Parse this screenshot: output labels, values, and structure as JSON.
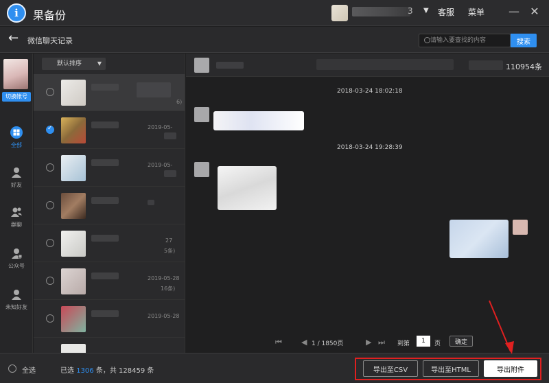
{
  "app": {
    "title": "果备份",
    "user_suffix": "3",
    "service": "客服",
    "menu": "菜单"
  },
  "header": {
    "title": "微信聊天记录",
    "search_placeholder": "请输入要查找的内容",
    "search_button": "搜索"
  },
  "leftnav": {
    "switch_account": "切换帐号",
    "items": [
      {
        "label": "全部",
        "icon": "grid-icon",
        "active": true
      },
      {
        "label": "好友",
        "icon": "person-icon",
        "active": false
      },
      {
        "label": "群聊",
        "icon": "group-icon",
        "active": false
      },
      {
        "label": "公众号",
        "icon": "official-account-icon",
        "active": false
      },
      {
        "label": "未知好友",
        "icon": "unknown-friend-icon",
        "active": false
      }
    ]
  },
  "conversations": {
    "sort_label": "默认排序",
    "rows": [
      {
        "date": "",
        "count": "6)",
        "checked": false,
        "selected": true
      },
      {
        "date": "2019-05-",
        "count": "",
        "checked": true,
        "selected": false
      },
      {
        "date": "2019-05-",
        "count": "",
        "checked": false,
        "selected": false
      },
      {
        "date": "",
        "count": "",
        "checked": false,
        "selected": false
      },
      {
        "date": "27",
        "count": "5条)",
        "checked": false,
        "selected": false
      },
      {
        "date": "2019-05-28",
        "count": "16条)",
        "checked": false,
        "selected": false
      },
      {
        "date": "2019-05-28",
        "count": "",
        "checked": false,
        "selected": false
      }
    ]
  },
  "chat": {
    "message_count": "110954条",
    "timestamps": [
      "2018-03-24 18:02:18",
      "2018-03-24 19:28:39"
    ],
    "pager": {
      "current": "1 / 1850页",
      "goto_label": "到第",
      "goto_value": "1",
      "page_unit": "页",
      "confirm": "确定"
    }
  },
  "footer": {
    "select_all": "全选",
    "selected_prefix": "已选",
    "selected_count": "1306",
    "selected_mid": "条，共",
    "total_count": "128459",
    "selected_suffix": "条",
    "export_csv": "导出至CSV",
    "export_html": "导出至HTML",
    "export_attachments": "导出附件"
  },
  "colors": {
    "accent": "#2f8ff0",
    "highlight": "#e02020"
  }
}
